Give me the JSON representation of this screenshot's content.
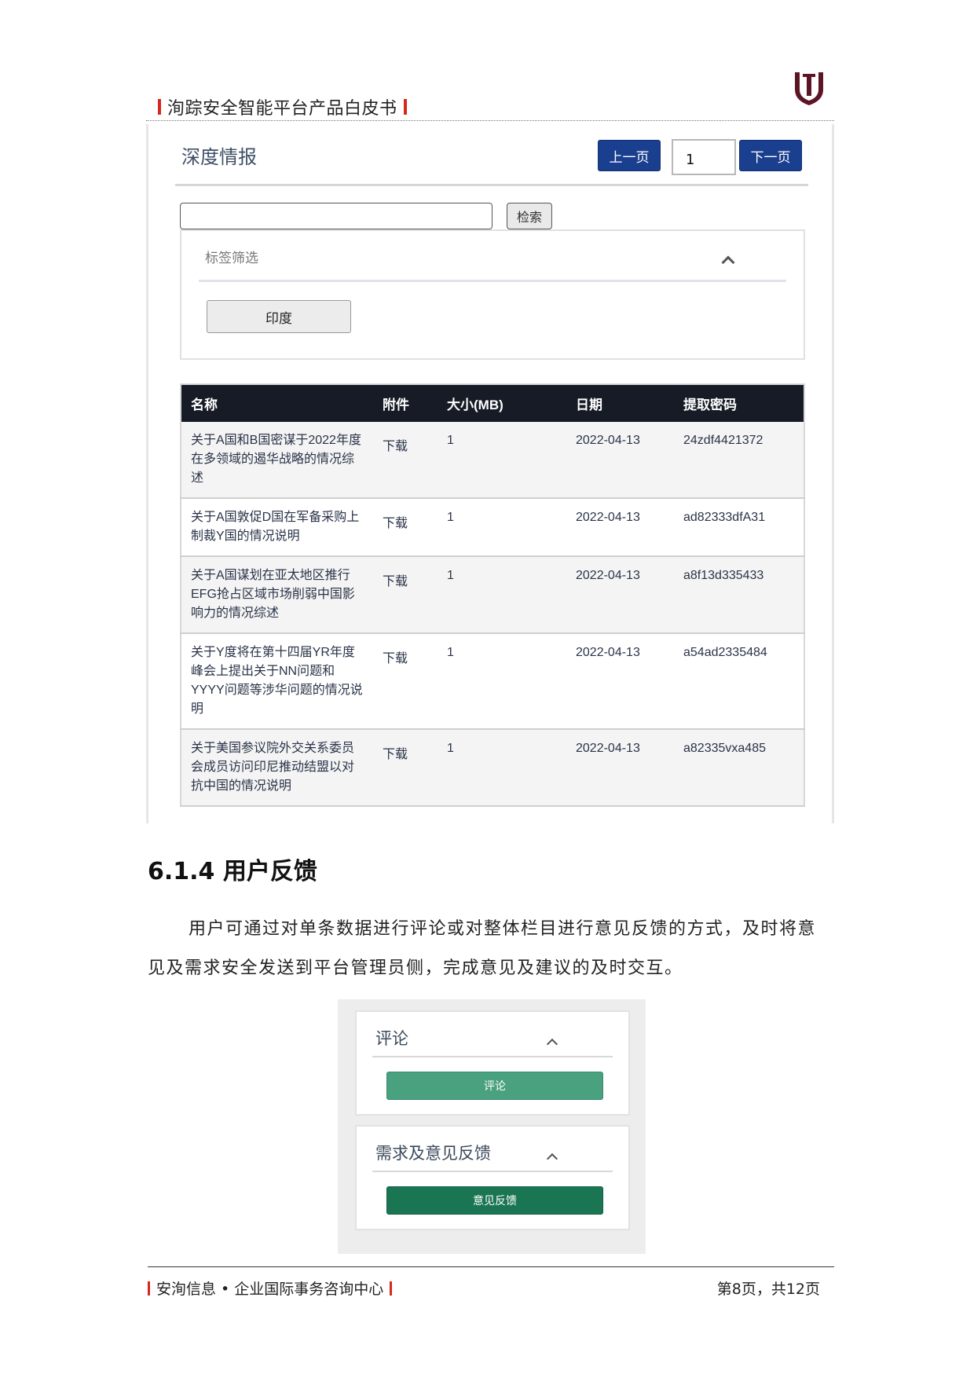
{
  "header": {
    "doc_title": "洵踪安全智能平台产品白皮书",
    "logo": "ij-shield-logo",
    "logo_color": "#5c1524"
  },
  "intel_panel": {
    "title": "深度情报",
    "prev_label": "上一页",
    "page_value": "1",
    "next_label": "下一页",
    "search_value": "",
    "search_button": "检索",
    "filter_label": "标签筛选",
    "tag": "印度",
    "columns": [
      "名称",
      "附件",
      "大小(MB)",
      "日期",
      "提取密码"
    ],
    "rows": [
      {
        "name": "关于A国和B国密谋于2022年度在多领域的遏华战略的情况综述",
        "attachment": "下载",
        "size": "1",
        "date": "2022-04-13",
        "password": "24zdf4421372"
      },
      {
        "name": "关于A国敦促D国在军备采购上制裁Y国的情况说明",
        "attachment": "下载",
        "size": "1",
        "date": "2022-04-13",
        "password": "ad82333dfA31"
      },
      {
        "name": "关于A国谋划在亚太地区推行EFG抢占区域市场削弱中国影响力的情况综述",
        "attachment": "下载",
        "size": "1",
        "date": "2022-04-13",
        "password": "a8f13d335433"
      },
      {
        "name": "关于Y度将在第十四届YR年度峰会上提出关于NN问题和YYYY问题等涉华问题的情况说明",
        "attachment": "下载",
        "size": "1",
        "date": "2022-04-13",
        "password": "a54ad2335484"
      },
      {
        "name": "关于美国参议院外交关系委员会成员访问印尼推动结盟以对抗中国的情况说明",
        "attachment": "下载",
        "size": "1",
        "date": "2022-04-13",
        "password": "a82335vxa485"
      }
    ],
    "accent_color": "#1b3f8f",
    "table_header_color": "#161b26"
  },
  "section": {
    "heading": "6.1.4 用户反馈",
    "paragraph": "用户可通过对单条数据进行评论或对整体栏目进行意见反馈的方式，及时将意见及需求安全发送到平台管理员侧，完成意见及建议的及时交互。"
  },
  "feedback_panel": {
    "comment_title": "评论",
    "comment_button": "评论",
    "feedback_title": "需求及意见反馈",
    "feedback_button": "意见反馈",
    "comment_color": "#4aa17f",
    "feedback_color": "#1a7553"
  },
  "footer": {
    "left": "安洵信息 • 企业国际事务咨询中心",
    "right": "第8页，共12页"
  }
}
